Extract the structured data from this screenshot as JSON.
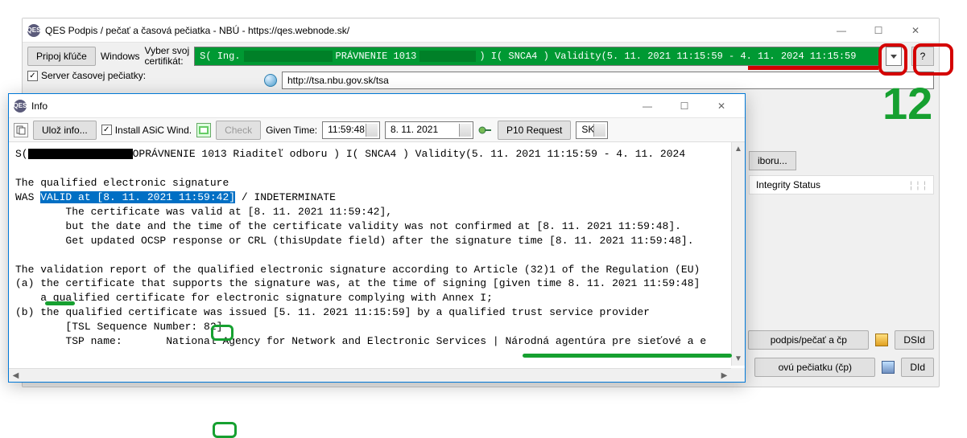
{
  "main": {
    "title": "QES Podpis / pečať a časová pečiatka - NBÚ - https://qes.webnode.sk/",
    "connect_keys": "Pripoj kľúče",
    "os_label": "Windows",
    "cert_label": "Vyber svoj\ncertifikát:",
    "cert_value_prefix": "S( Ing.",
    "cert_value_mid": "PRÁVNENIE 1013",
    "cert_value_suffix": ") I( SNCA4 ) Validity(5. 11. 2021 11:15:59 - 4. 11. 2024 11:15:59",
    "help": "?",
    "url": "http://tsa.nbu.gov.sk/tsa",
    "server_checkbox": "Server časovej pečiatky:",
    "right_tab": "iboru...",
    "right_header": "Integrity Status",
    "btn_sign": "podpis/pečať a čp",
    "btn_dsid": "DSId",
    "btn_stamp": "ovú pečiatku (čp)",
    "btn_did": "DId"
  },
  "info": {
    "title": "Info",
    "save_info": "Ulož info...",
    "install_asic": "Install ASiC Wind.",
    "check": "Check",
    "given_time_label": "Given Time:",
    "given_time": "11:59:48",
    "given_date": "8. 11. 2021",
    "p10": "P10 Request",
    "lang": "SK",
    "body_line1_a": "S(",
    "body_line1_b": "OPRÁVNENIE 1013 Riaditeľ odboru ) I( SNCA4 ) Validity(5. 11. 2021 11:15:59 - 4. 11. 2024",
    "body_line2": "The qualified electronic signature",
    "body_line3_a": "WAS ",
    "body_line3_sel": "VALID at [8. 11. 2021 11:59:42]",
    "body_line3_b": " / INDETERMINATE",
    "body_line4": "        The certificate was valid at [8. 11. 2021 11:59:42],",
    "body_line5": "        but the date and the time of the certificate validity was not confirmed at [8. 11. 2021 11:59:48].",
    "body_line6": "        Get updated OCSP response or CRL (thisUpdate field) after the signature time [8. 11. 2021 11:59:48].",
    "body_line7": "The validation report of the qualified electronic signature according to Article (32)1 of the Regulation (EU)",
    "body_line8": "(a) the certificate that supports the signature was, at the time of signing [given time 8. 11. 2021 11:59:48]",
    "body_line9": "    a qualified certificate for electronic signature complying with Annex I;",
    "body_line10": "(b) the qualified certificate was issued [5. 11. 2021 11:15:59] by a qualified trust service provider",
    "body_line11_a": "        [TSL Sequence Number:",
    "body_line11_num": " 82",
    "body_line11_b": "]",
    "body_line12": "        TSP name:       National Agency for Network and Electronic Services | Národná agentúra pre sieťové a e"
  },
  "annotations": {
    "big_number": "12"
  }
}
